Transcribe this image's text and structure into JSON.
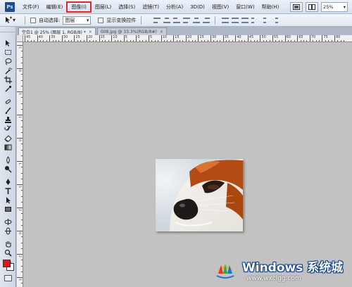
{
  "menubar": {
    "logo": "Ps",
    "items": [
      "文件(F)",
      "编辑(E)",
      "图像(I)",
      "图层(L)",
      "选择(S)",
      "滤镜(T)",
      "分析(A)",
      "3D(D)",
      "视图(V)",
      "窗口(W)",
      "帮助(H)"
    ],
    "highlighted_item": "图像(I)",
    "zoom": "25%"
  },
  "options": {
    "auto_select_label": "自动选择:",
    "auto_select_value": "图层",
    "show_transform_label": "显示变换控件"
  },
  "tabs": [
    {
      "title": "空白1 @ 25% (图层 1, RGB/8) *",
      "close": "×",
      "active": true
    },
    {
      "title": "008.jpg @ 33.3%(RGB/8#)",
      "close": "×",
      "active": false
    }
  ],
  "ruler": {
    "h_labels": [
      "45",
      "40",
      "35",
      "30",
      "25",
      "20",
      "15",
      "10",
      "5",
      "0",
      "5",
      "10",
      "15",
      "20",
      "25",
      "30",
      "35",
      "40",
      "45",
      "50",
      "55",
      "60",
      "65",
      "70",
      "75",
      "80"
    ],
    "v_labels": [
      "5",
      "0",
      "5",
      "1",
      "0",
      "1",
      "5",
      "2",
      "0",
      "2",
      "5"
    ]
  },
  "tools": [
    "move-tool",
    "marquee-tool",
    "lasso-tool",
    "magic-wand-tool",
    "crop-tool",
    "eyedropper-tool",
    "healing-tool",
    "brush-tool",
    "clone-stamp-tool",
    "history-brush-tool",
    "eraser-tool",
    "gradient-tool",
    "blur-tool",
    "dodge-tool",
    "pen-tool",
    "type-tool",
    "path-select-tool",
    "shape-tool",
    "3d-rotate-tool",
    "3d-orbit-tool",
    "hand-tool",
    "zoom-tool"
  ],
  "colors": {
    "foreground": "#e1141a",
    "background": "#ffffff",
    "highlight": "#e0262a",
    "canvas": "#c2c2c2"
  },
  "watermark": {
    "title": "Windows 系统城",
    "url": "www.wxclgg.com"
  }
}
